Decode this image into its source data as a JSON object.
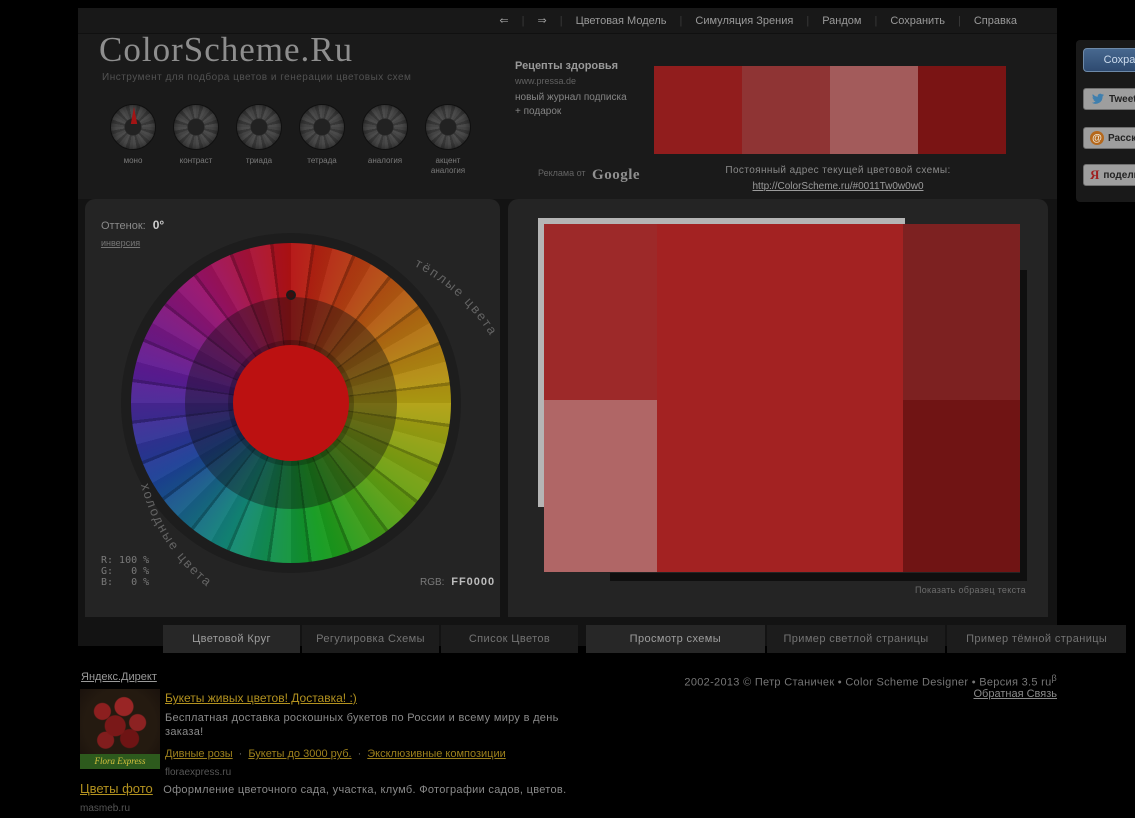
{
  "nav": {
    "back": "⇐",
    "forward": "⇒",
    "separator": "|",
    "items": [
      "Цветовая Модель",
      "Симуляция Зрения",
      "Рандом",
      "Сохранить",
      "Справка"
    ]
  },
  "logo": {
    "title": "ColorScheme.Ru",
    "tagline": "Инструмент для подбора цветов и генерации цветовых схем"
  },
  "modes": {
    "selected": "моно",
    "items": [
      {
        "label": "моно"
      },
      {
        "label": "контраст"
      },
      {
        "label": "триада"
      },
      {
        "label": "тетрада"
      },
      {
        "label": "аналогия"
      },
      {
        "label": "акцент аналогия"
      }
    ]
  },
  "ad_top": {
    "title": "Рецепты здоровья",
    "url": "www.pressa.de",
    "line1": "новый журнал подписка",
    "line2": "+ подарок",
    "sponsor_prefix": "Реклама от",
    "sponsor": "Google"
  },
  "permalink": {
    "label": "Постоянный адрес текущей цветовой схемы:",
    "url": "http://ColorScheme.ru/#0011Tw0w0w0"
  },
  "share": {
    "save": "Сохранить",
    "tweet": "Tweet",
    "mailru": "Рассказать",
    "mailru_icon": "@",
    "yandex": "поделиться",
    "yandex_icon": "Я"
  },
  "wheel_panel": {
    "hue_label": "Оттенок:",
    "hue_value": "0°",
    "invert_link": "инверсия",
    "warm_label": "тёплые цвета",
    "cold_label": "холодные цвета",
    "rgb_rows": [
      "R: 100 %",
      "G:   0 %",
      "B:   0 %"
    ],
    "rgb_label": "RGB:",
    "rgb_value": "FF0000"
  },
  "left_tabs": [
    "Цветовой Круг",
    "Регулировка Схемы",
    "Список Цветов"
  ],
  "right_tabs": [
    "Просмотр схемы",
    "Пример светлой страницы",
    "Пример тёмной страницы"
  ],
  "preview": {
    "sample_text_link": "Показать образец текста"
  },
  "footer": {
    "copyright": "2002-2013 © Петр Станичек • Color Scheme Designer • Версия 3.5 ru",
    "version_sup": "β",
    "feedback": "Обратная Связь",
    "yandex_direct": "Яндекс.Директ",
    "ad1": {
      "title": "Букеты живых цветов! Доставка! :)",
      "body": "Бесплатная доставка роскошных букетов по России и всему миру в день заказа!",
      "links": [
        "Дивные розы",
        "Букеты до 3000 руб.",
        "Эксклюзивные композиции"
      ],
      "separator": "·",
      "domain": "floraexpress.ru",
      "image_label": "Flora Express"
    },
    "ad2": {
      "title": "Цветы фото",
      "body": "Оформление цветочного сада, участка, клумб. Фотографии садов, цветов.",
      "domain": "masmeb.ru"
    }
  },
  "colors": {
    "accent": "#bc1111",
    "swatches": [
      "#911d1d",
      "#8f3434",
      "#a35b5b",
      "#7a1414"
    ],
    "preview_blocks": {
      "top_left": "#9d2929",
      "center": "#a32222",
      "top_right": "#7d2121",
      "bottom_left": "#b06666",
      "bottom_right": "#701414",
      "light_frame": "#b5b5b5",
      "dark_frame": "#0f0f0f"
    }
  }
}
